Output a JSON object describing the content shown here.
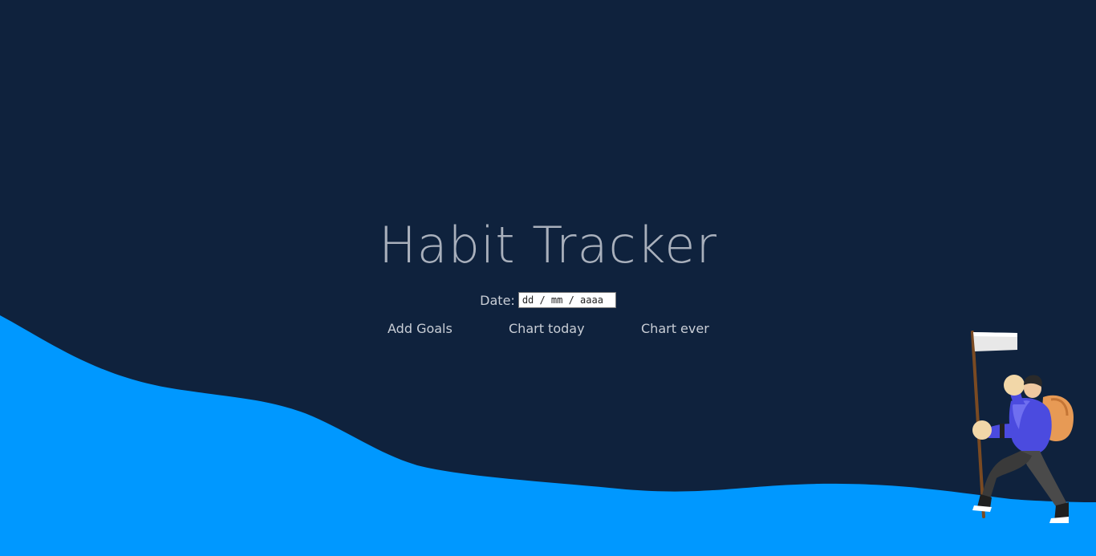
{
  "app": {
    "title": "Habit Tracker"
  },
  "date_field": {
    "label": "Date:",
    "placeholder": "dd / mm / aaaa",
    "value": ""
  },
  "nav": {
    "items": [
      {
        "label": "Add Goals"
      },
      {
        "label": "Chart today"
      },
      {
        "label": "Chart ever"
      }
    ]
  },
  "illustration": {
    "icon": "hiker-with-flag-icon"
  },
  "colors": {
    "background": "#0f223d",
    "wave": "#0098ff",
    "title": "#a9b0bc",
    "text": "#c9ced6"
  }
}
